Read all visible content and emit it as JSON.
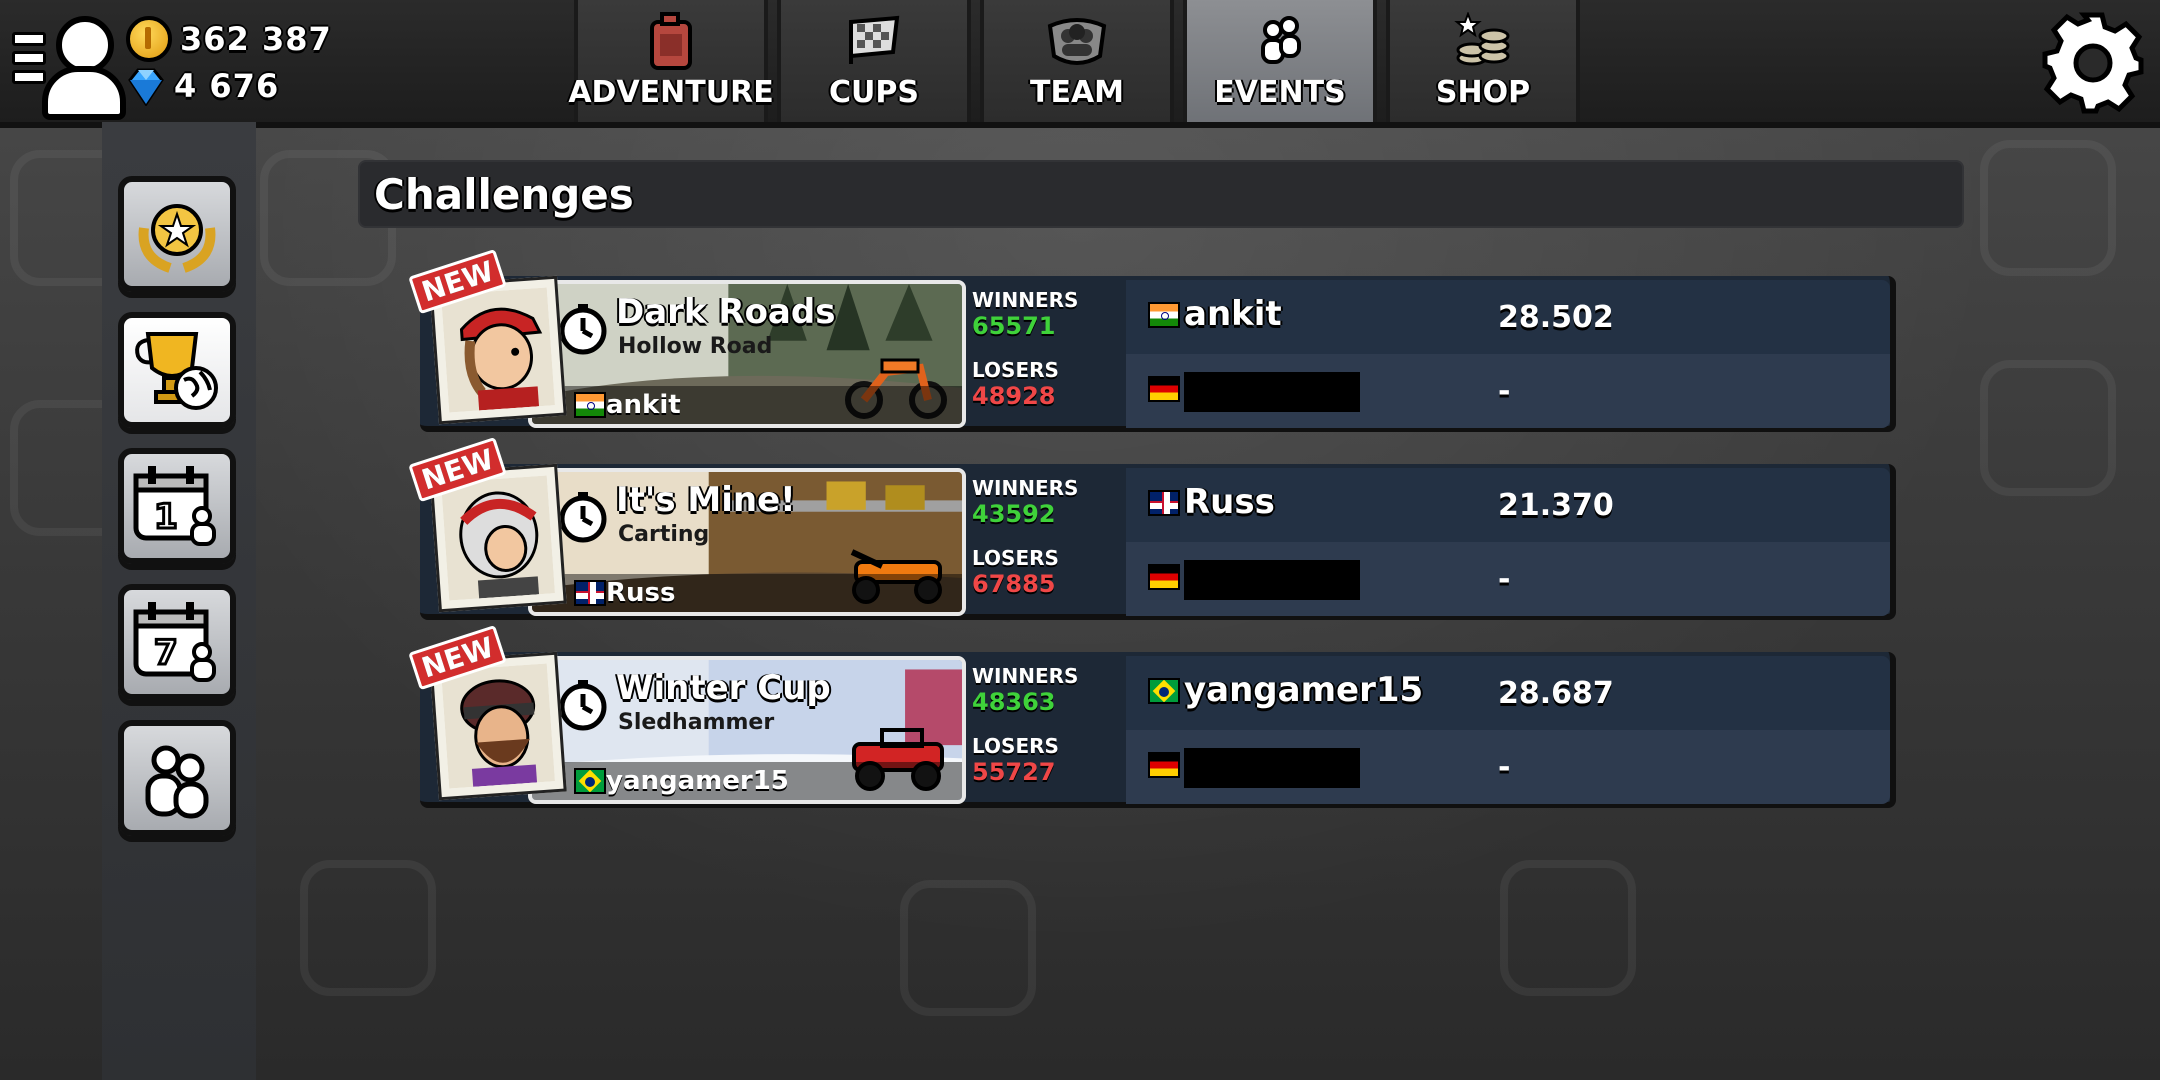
{
  "currency": {
    "coins": "362 387",
    "gems": "4 676"
  },
  "tabs": [
    {
      "label": "ADVENTURE",
      "icon": "fuel-can-icon",
      "active": false
    },
    {
      "label": "CUPS",
      "icon": "checkered-flag-icon",
      "active": false
    },
    {
      "label": "TEAM",
      "icon": "team-emblem-icon",
      "active": false
    },
    {
      "label": "EVENTS",
      "icon": "people-icon",
      "active": true
    },
    {
      "label": "SHOP",
      "icon": "coin-stacks-icon",
      "active": false
    }
  ],
  "sidebar": [
    {
      "name": "star-laurel-icon",
      "active": false
    },
    {
      "name": "trophy-globe-icon",
      "active": true
    },
    {
      "name": "calendar-1-day-icon",
      "text": "1",
      "active": false
    },
    {
      "name": "calendar-7-day-icon",
      "text": "7",
      "active": false
    },
    {
      "name": "friends-icon",
      "active": false
    }
  ],
  "challenges_title": "Challenges",
  "badge_new": "NEW",
  "labels": {
    "winners": "WINNERS",
    "losers": "LOSERS"
  },
  "challenges": [
    {
      "track": "Dark Roads",
      "vehicle": "Hollow Road",
      "record_holder": "ankit",
      "record_flag": "india",
      "winners": "65571",
      "losers": "48928",
      "top_player": "ankit",
      "top_time": "28.502",
      "bottom_time": "-",
      "is_new": true
    },
    {
      "track": "It's Mine!",
      "vehicle": "Carting",
      "record_holder": "Russ",
      "record_flag": "uk",
      "winners": "43592",
      "losers": "67885",
      "top_player": "Russ",
      "top_time": "21.370",
      "bottom_time": "-",
      "is_new": true
    },
    {
      "track": "Winter Cup",
      "vehicle": "Sledhammer",
      "record_holder": "yangamer15",
      "record_flag": "brazil",
      "winners": "48363",
      "losers": "55727",
      "top_player": "yangamer15",
      "top_time": "28.687",
      "bottom_time": "-",
      "is_new": true
    }
  ],
  "colors": {
    "winners": "#3fd23a",
    "losers": "#f04747",
    "active_tab": "#7f8287"
  }
}
